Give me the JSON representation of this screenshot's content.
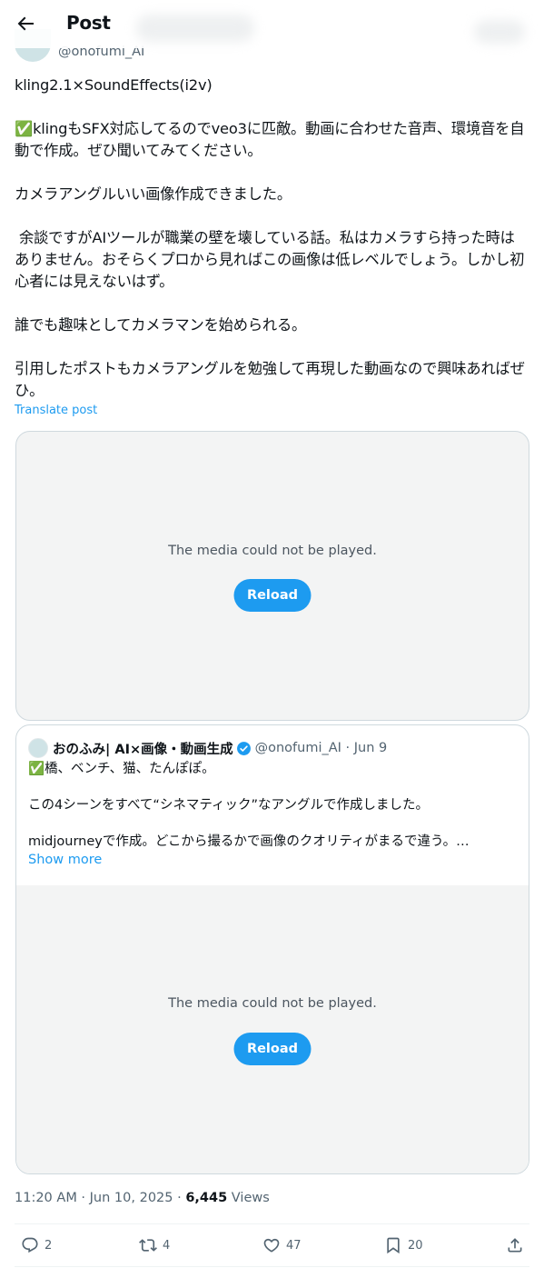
{
  "header": {
    "title": "Post"
  },
  "author": {
    "handle": "@onofumi_AI"
  },
  "tweet": {
    "text": "kling2.1×SoundEffects(i2v)\n\n✅klingもSFX対応してるのでveo3に匹敵。動画に合わせた音声、環境音を自動で作成。ぜひ聞いてみてください。\n\nカメラアングルいい画像作成できました。\n\n 余談ですがAIツールが職業の壁を壊している話。私はカメラすら持った時はありません。おそらくプロから見ればこの画像は低レベルでしょう。しかし初心者には見えないはず。\n\n誰でも趣味としてカメラマンを始められる。\n\n引用したポストもカメラアングルを勉強して再現した動画なので興味あればぜひ。",
    "translate_label": "Translate post"
  },
  "media": {
    "message": "The media could not be played.",
    "reload_label": "Reload"
  },
  "quote": {
    "name": "おのふみ| AI×画像・動画生成",
    "handle_date": "@onofumi_AI · Jun 9",
    "text": "✅橋、ベンチ、猫、たんぽぽ。\n\nこの4シーンをすべて“シネマティック”なアングルで作成しました。\n\nmidjourneyで作成。どこから撮るかで画像のクオリティがまるで違う。…",
    "show_more": "Show more",
    "media": {
      "message": "The media could not be played.",
      "reload_label": "Reload"
    }
  },
  "meta": {
    "time_date": "11:20 AM · Jun 10, 2025 · ",
    "views_count": "6,445",
    "views_label": " Views"
  },
  "actions": {
    "replies": "2",
    "reposts": "4",
    "likes": "47",
    "bookmarks": "20"
  },
  "colors": {
    "accent": "#1d9bf0",
    "muted": "#536471",
    "border": "#cfd9de",
    "media_bg": "#f3f4f4"
  }
}
